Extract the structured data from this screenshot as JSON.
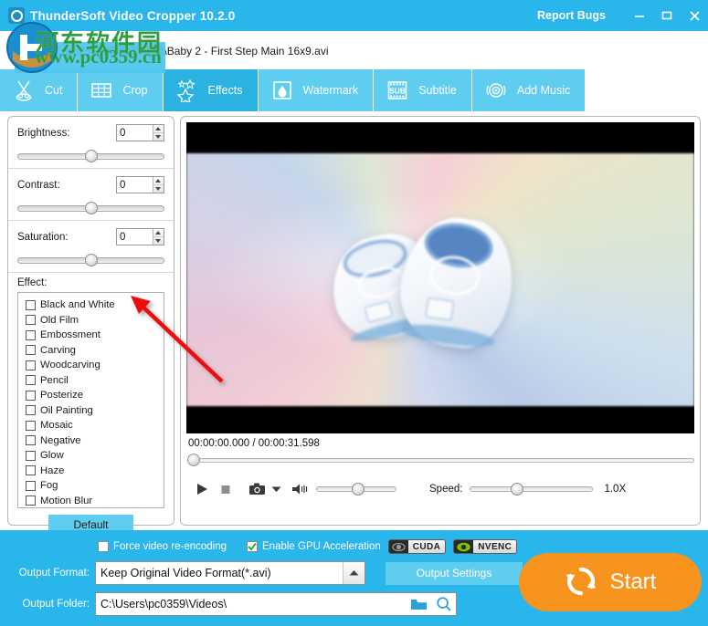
{
  "window": {
    "title": "ThunderSoft Video Cropper 10.2.0",
    "app_icon": "film-reel-icon",
    "report_bugs": "Report Bugs",
    "minimize": "minimize-icon",
    "maximize": "maximize-icon",
    "close": "close-icon",
    "accent_blue": "#29b6ea",
    "tab_blue": "#5fcdf0",
    "tab_active_blue": "#2ab3e0",
    "start_orange": "#f7941e"
  },
  "filebar": {
    "add_file_label": "Add File",
    "path": "\\pc0359\\桌面\\新视频\\Baby 2 - First Step Main 16x9.avi"
  },
  "tabs": [
    {
      "label": "Cut",
      "icon": "scissors-icon",
      "active": false
    },
    {
      "label": "Crop",
      "icon": "crop-grid-icon",
      "active": false
    },
    {
      "label": "Effects",
      "icon": "stars-icon",
      "active": true
    },
    {
      "label": "Watermark",
      "icon": "water-drop-icon",
      "active": false
    },
    {
      "label": "Subtitle",
      "icon": "subtitle-film-icon",
      "active": false
    },
    {
      "label": "Add Music",
      "icon": "music-disc-icon",
      "active": false
    }
  ],
  "adjustments": [
    {
      "label": "Brightness:",
      "value": "0",
      "slider_percent": 50
    },
    {
      "label": "Contrast:",
      "value": "0",
      "slider_percent": 50
    },
    {
      "label": "Saturation:",
      "value": "0",
      "slider_percent": 50
    }
  ],
  "effects": {
    "title": "Effect:",
    "items": [
      {
        "label": "Black and White",
        "checked": false
      },
      {
        "label": "Old Film",
        "checked": false
      },
      {
        "label": "Embossment",
        "checked": false
      },
      {
        "label": "Carving",
        "checked": false
      },
      {
        "label": "Woodcarving",
        "checked": false
      },
      {
        "label": "Pencil",
        "checked": false
      },
      {
        "label": "Posterize",
        "checked": false
      },
      {
        "label": "Oil Painting",
        "checked": false
      },
      {
        "label": "Mosaic",
        "checked": false
      },
      {
        "label": "Negative",
        "checked": false
      },
      {
        "label": "Glow",
        "checked": false
      },
      {
        "label": "Haze",
        "checked": false
      },
      {
        "label": "Fog",
        "checked": false
      },
      {
        "label": "Motion Blur",
        "checked": false
      }
    ],
    "default_button": "Default"
  },
  "player": {
    "time_display": "00:00:00.000 / 00:00:31.598",
    "seek_percent": 0,
    "play_icon": "play-icon",
    "stop_icon": "stop-icon",
    "snapshot_icon": "camera-icon",
    "snapshot_dropdown_icon": "chevron-down-icon",
    "volume_icon": "speaker-icon",
    "volume_percent": 52,
    "speed_label": "Speed:",
    "speed_percent": 38,
    "speed_value": "1.0X"
  },
  "options": {
    "force_reencode_label": "Force video re-encoding",
    "force_reencode_checked": false,
    "gpu_label": "Enable GPU Acceleration",
    "gpu_checked": true,
    "badges": [
      {
        "label": "CUDA",
        "icon": "nvidia-eye-icon",
        "style": "cuda"
      },
      {
        "label": "NVENC",
        "icon": "nvidia-eye-icon",
        "style": "nvenc"
      }
    ]
  },
  "output": {
    "format_label": "Output Format:",
    "format_value": "Keep Original Video Format(*.avi)",
    "format_arrow_icon": "chevron-up-icon",
    "settings_button": "Output Settings",
    "folder_label": "Output Folder:",
    "folder_value": "C:\\Users\\pc0359\\Videos\\",
    "folder_browse_icon": "folder-icon",
    "folder_search_icon": "search-icon",
    "start_button": "Start",
    "start_icon": "refresh-sync-icon"
  },
  "watermark": {
    "site_cn": "河东软件园",
    "site_url": "www.pc0359.cn",
    "logo": "circular-site-logo"
  },
  "annotation": {
    "arrow": "red-arrow-pointing-to-effect-list"
  }
}
